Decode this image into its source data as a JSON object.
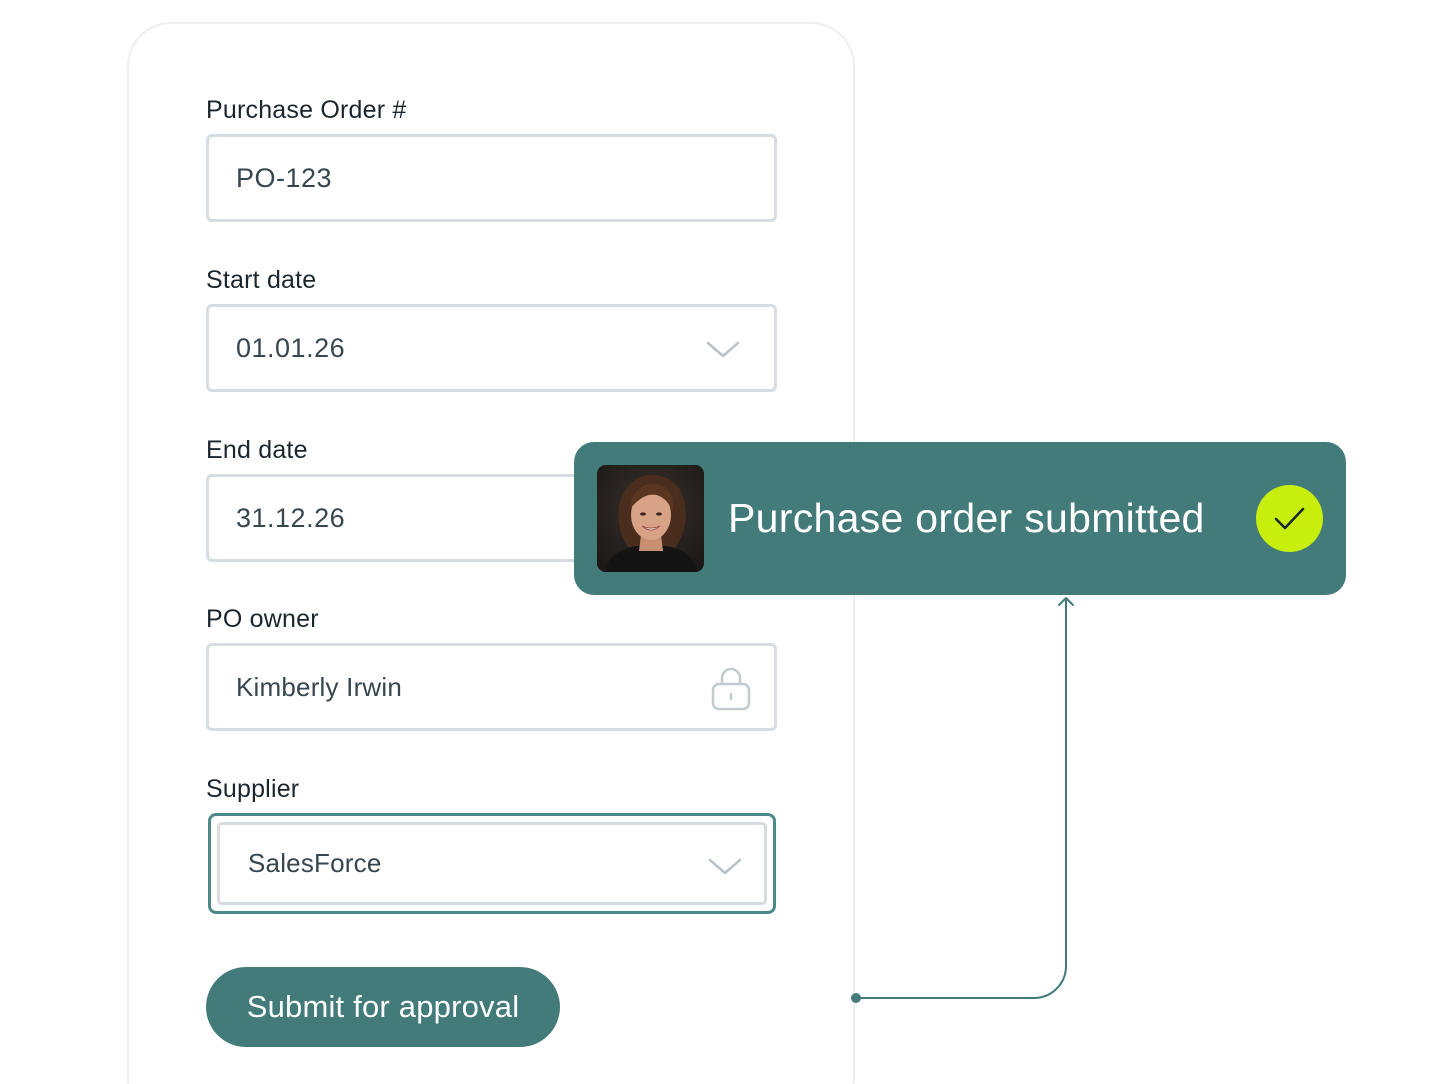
{
  "form": {
    "purchase_order": {
      "label": "Purchase Order #",
      "value": "PO-123"
    },
    "start_date": {
      "label": "Start date",
      "value": "01.01.26",
      "icon": "chevron-down-icon"
    },
    "end_date": {
      "label": "End date",
      "value": "31.12.26"
    },
    "po_owner": {
      "label": "PO owner",
      "value": "Kimberly Irwin",
      "icon": "lock-icon"
    },
    "supplier": {
      "label": "Supplier",
      "value": "SalesForce",
      "icon": "chevron-down-icon"
    },
    "submit_label": "Submit for approval"
  },
  "notification": {
    "message": "Purchase order submitted",
    "avatar": "user-avatar-photo",
    "status_icon": "checkmark-icon"
  },
  "colors": {
    "accent": "#437b7b",
    "success": "#c8ee0e",
    "border": "#d6dcdf",
    "focus_border": "#4f8a8a",
    "text": "#1c262e"
  }
}
